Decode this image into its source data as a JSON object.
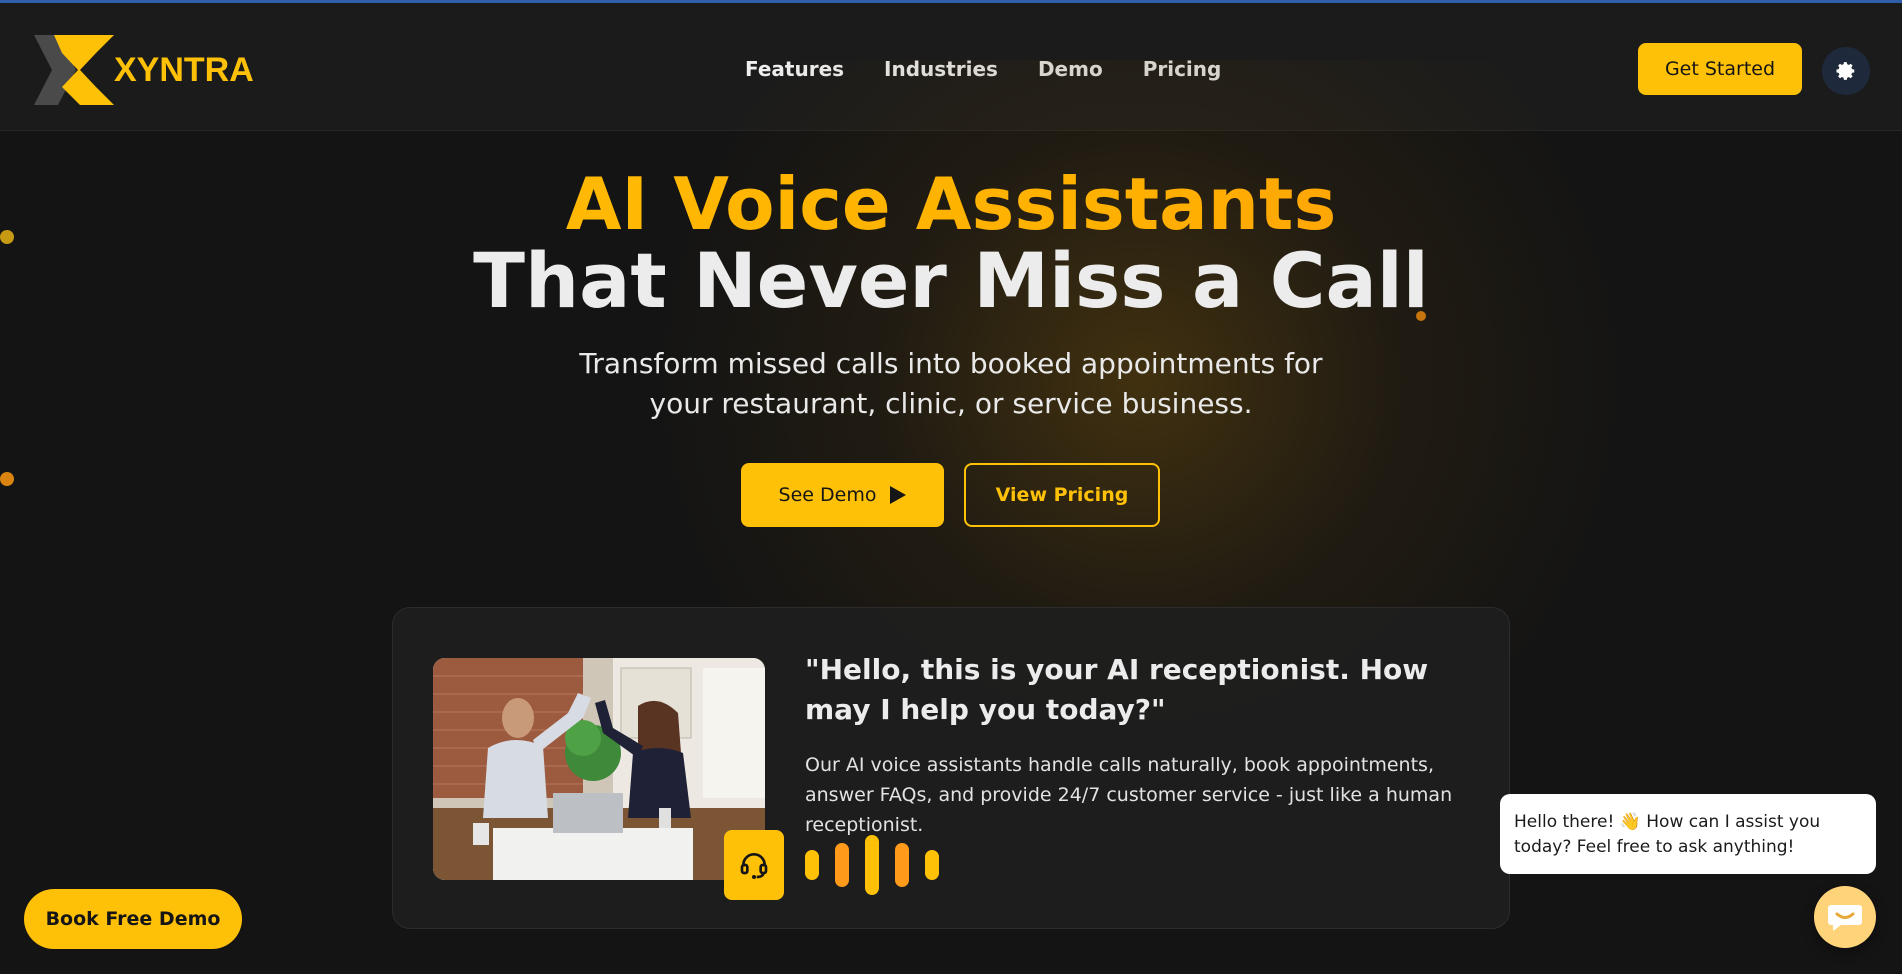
{
  "brand": {
    "name": "XYNTRA",
    "accent": "#ffc107"
  },
  "nav": {
    "items": [
      "Features",
      "Industries",
      "Demo",
      "Pricing"
    ]
  },
  "header": {
    "cta_label": "Get Started",
    "theme_icon": "gear-icon"
  },
  "hero": {
    "title_line1": "AI Voice Assistants",
    "title_line2": "That Never Miss a Call",
    "subtitle": "Transform missed calls into booked appointments for your restaurant, clinic, or service business.",
    "primary_button": "See Demo",
    "primary_icon": "play-icon",
    "secondary_button": "View Pricing"
  },
  "card": {
    "quote": "\"Hello, this is your AI receptionist. How may I help you today?\"",
    "description": "Our AI voice assistants handle calls naturally, book appointments, answer FAQs, and provide 24/7 customer service - just like a human receptionist.",
    "badge_icon": "headset-icon",
    "photo_icon": "photo-business-people-high-five"
  },
  "floating": {
    "book_demo": "Book Free Demo",
    "chat_message": "Hello there! 👋 How can I assist you today? Feel free to ask anything!",
    "chat_icon": "chat-icon"
  }
}
